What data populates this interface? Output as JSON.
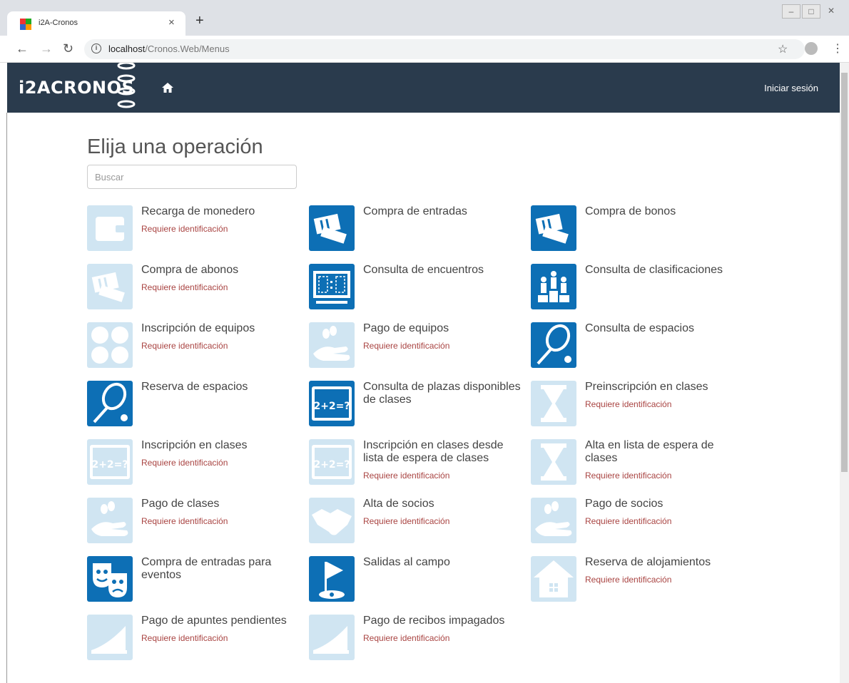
{
  "browser": {
    "tab_title": "i2A-Cronos",
    "tab_close": "×",
    "new_tab": "+",
    "url_host": "localhost",
    "url_path": "/Cronos.Web/Menus"
  },
  "header": {
    "logo_text": "i2ACRONOS",
    "login_label": "Iniciar sesión"
  },
  "main": {
    "title": "Elija una operación",
    "search_placeholder": "Buscar",
    "requires_id_text": "Requiere identificación",
    "operations": [
      {
        "label": "Recarga de monedero",
        "requires_id": true,
        "icon": "wallet-icon",
        "enabled": false
      },
      {
        "label": "Compra de entradas",
        "requires_id": false,
        "icon": "tickets-icon",
        "enabled": true
      },
      {
        "label": "Compra de bonos",
        "requires_id": false,
        "icon": "tickets-icon",
        "enabled": true
      },
      {
        "label": "Compra de abonos",
        "requires_id": true,
        "icon": "tickets-icon",
        "enabled": false
      },
      {
        "label": "Consulta de encuentros",
        "requires_id": false,
        "icon": "scoreboard-icon",
        "enabled": true
      },
      {
        "label": "Consulta de clasificaciones",
        "requires_id": false,
        "icon": "podium-icon",
        "enabled": true
      },
      {
        "label": "Inscripción de equipos",
        "requires_id": true,
        "icon": "balls-icon",
        "enabled": false
      },
      {
        "label": "Pago de equipos",
        "requires_id": true,
        "icon": "coins-hand-icon",
        "enabled": false
      },
      {
        "label": "Consulta de espacios",
        "requires_id": false,
        "icon": "racket-icon",
        "enabled": true
      },
      {
        "label": "Reserva de espacios",
        "requires_id": false,
        "icon": "racket-icon",
        "enabled": true
      },
      {
        "label": "Consulta de plazas disponibles de clases",
        "requires_id": false,
        "icon": "blackboard-icon",
        "enabled": true
      },
      {
        "label": "Preinscripción en clases",
        "requires_id": true,
        "icon": "hourglass-icon",
        "enabled": false
      },
      {
        "label": "Inscripción en clases",
        "requires_id": true,
        "icon": "blackboard-icon",
        "enabled": false
      },
      {
        "label": "Inscripción en clases desde lista de espera de clases",
        "requires_id": true,
        "icon": "blackboard-icon",
        "enabled": false
      },
      {
        "label": "Alta en lista de espera de clases",
        "requires_id": true,
        "icon": "hourglass-icon",
        "enabled": false
      },
      {
        "label": "Pago de clases",
        "requires_id": true,
        "icon": "coins-hand-icon",
        "enabled": false
      },
      {
        "label": "Alta de socios",
        "requires_id": true,
        "icon": "handshake-icon",
        "enabled": false
      },
      {
        "label": "Pago de socios",
        "requires_id": true,
        "icon": "coins-hand-icon",
        "enabled": false
      },
      {
        "label": "Compra de entradas para eventos",
        "requires_id": false,
        "icon": "theater-masks-icon",
        "enabled": true
      },
      {
        "label": "Salidas al campo",
        "requires_id": false,
        "icon": "golf-flag-icon",
        "enabled": true
      },
      {
        "label": "Reserva de alojamientos",
        "requires_id": true,
        "icon": "house-icon",
        "enabled": false
      },
      {
        "label": "Pago de apuntes pendientes",
        "requires_id": true,
        "icon": "receipt-icon",
        "enabled": false
      },
      {
        "label": "Pago de recibos impagados",
        "requires_id": true,
        "icon": "receipt-icon",
        "enabled": false
      }
    ]
  },
  "colors": {
    "header_bg": "#2a3b4d",
    "icon_enabled": "#0d6fb5",
    "icon_disabled": "#d0e5f2",
    "requires_id": "#a94442"
  }
}
